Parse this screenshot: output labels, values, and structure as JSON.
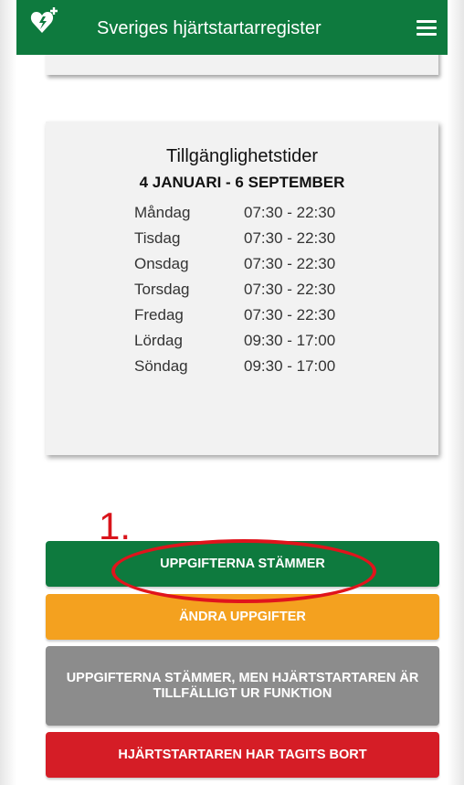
{
  "header": {
    "title": "Sveriges hjärtstartarregister",
    "brand_color": "#0e7a3e"
  },
  "availability": {
    "title": "Tillgänglighetstider",
    "date_range": "4 JANUARI - 6 SEPTEMBER",
    "schedule": [
      {
        "day": "Måndag",
        "hours": "07:30 - 22:30"
      },
      {
        "day": "Tisdag",
        "hours": "07:30 - 22:30"
      },
      {
        "day": "Onsdag",
        "hours": "07:30 - 22:30"
      },
      {
        "day": "Torsdag",
        "hours": "07:30 - 22:30"
      },
      {
        "day": "Fredag",
        "hours": "07:30 - 22:30"
      },
      {
        "day": "Lördag",
        "hours": "09:30 - 17:00"
      },
      {
        "day": "Söndag",
        "hours": "09:30 - 17:00"
      }
    ]
  },
  "annotation": {
    "step": "1."
  },
  "actions": {
    "confirm": "UPPGIFTERNA STÄMMER",
    "edit": "ÄNDRA UPPGIFTER",
    "out_of_order": "UPPGIFTERNA STÄMMER, MEN HJÄRTSTARTAREN ÄR TILLFÄLLIGT UR FUNKTION",
    "removed": "HJÄRTSTARTAREN HAR TAGITS BORT"
  },
  "colors": {
    "confirm": "#0e7a3e",
    "edit": "#f4a11f",
    "out_of_order": "#8c8c8c",
    "removed": "#d51d26",
    "annotation": "#e0141c"
  }
}
